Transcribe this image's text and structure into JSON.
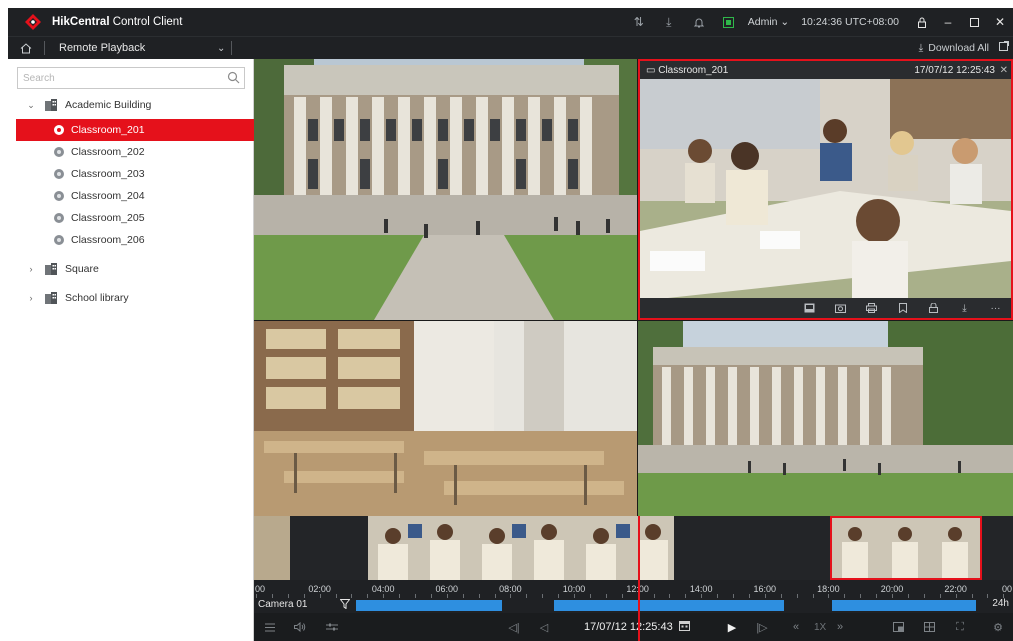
{
  "app": {
    "title_bold": "HikCentral",
    "title_rest": "Control Client",
    "user": "Admin",
    "clock": "10:24:36 UTC+08:00",
    "accent": "#e5111b"
  },
  "module": {
    "title": "Remote Playback",
    "download_all": "Download All"
  },
  "search": {
    "placeholder": "Search"
  },
  "tree": {
    "groups": [
      {
        "label": "Academic Building",
        "expanded": true
      },
      {
        "label": "Square",
        "expanded": false
      },
      {
        "label": "School library",
        "expanded": false
      }
    ],
    "cameras": [
      {
        "label": "Classroom_201",
        "selected": true
      },
      {
        "label": "Classroom_202",
        "selected": false
      },
      {
        "label": "Classroom_203",
        "selected": false
      },
      {
        "label": "Classroom_204",
        "selected": false
      },
      {
        "label": "Classroom_205",
        "selected": false
      },
      {
        "label": "Classroom_206",
        "selected": false
      }
    ]
  },
  "active_tile": {
    "camera": "Classroom_201",
    "timestamp": "17/07/12 12:25:43"
  },
  "timeline": {
    "ticks": [
      "00",
      "02:00",
      "04:00",
      "06:00",
      "08:00",
      "10:00",
      "12:00",
      "14:00",
      "16:00",
      "18:00",
      "20:00",
      "22:00",
      "00"
    ],
    "camera_label": "Camera 01",
    "span_label": "24h"
  },
  "controls": {
    "time": "17/07/12 12:25:43",
    "speed": "1X"
  }
}
